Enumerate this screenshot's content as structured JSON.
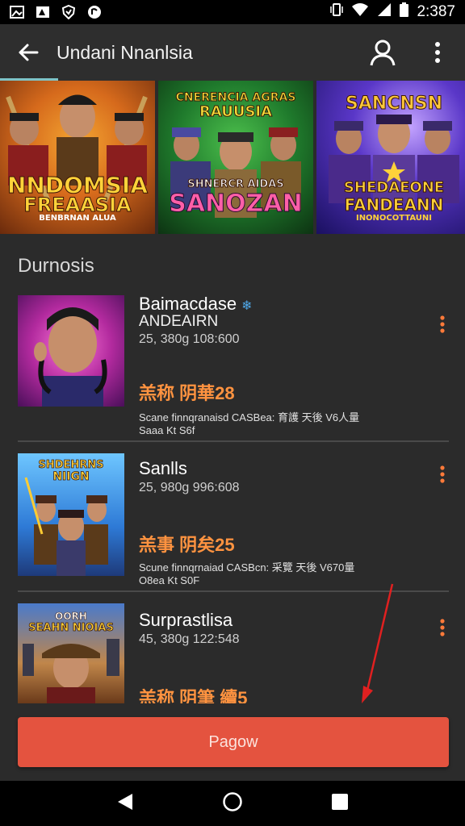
{
  "status_bar": {
    "time": "2:387"
  },
  "app_bar": {
    "title": "Undani Nnanlsia"
  },
  "banner": [
    {
      "title_line1": "NNDOMSIA",
      "title_line2": "FREAASIA",
      "caption": "BENBRNAN ALUA"
    },
    {
      "title_top1": "CNERENCIA AGRAS",
      "title_top2": "RAUUSIA",
      "title_line1": "SHNERCR AIDAS",
      "title_line2": "SANOZAN"
    },
    {
      "title_top1": "SANCNSN",
      "title_line1": "SHEDAEONE",
      "title_line2": "FANDEANN",
      "caption": "INONOCOTTAUNI"
    }
  ],
  "section": {
    "title": "Durnosis"
  },
  "items": [
    {
      "title": "Baimacdase",
      "verified": true,
      "subtitle": "ANDEAIRN",
      "meta": "25, 380g 108:600",
      "price": "羔称 阴華28",
      "desc1": "Scane finnqranaisd CASBea: 育護 天後 V6人量",
      "desc2": "Saaa Kt S6f"
    },
    {
      "title": "Sanlls",
      "verified": false,
      "subtitle": "",
      "meta": "25, 980g 996:608",
      "price": "羔事 阴矣25",
      "desc1": "Scune finnqrnaiad CASBcn: 采覽 天後 V670量",
      "desc2": "O8ea Kt S0F",
      "thumb_top": "SHDEHRNS",
      "thumb_bottom": "NIIGN"
    },
    {
      "title": "Surprastlisa",
      "verified": false,
      "subtitle": "",
      "meta": "45, 380g 122:548",
      "price": "羔称 阴筆 續5",
      "desc1": "",
      "desc2": "",
      "thumb_top": "OORH",
      "thumb_bottom": "SEAHN NIOIAS"
    }
  ],
  "primary_button": {
    "label": "Pagow"
  },
  "colors": {
    "accent": "#e4533f",
    "price": "#ff9340",
    "background": "#2b2b2b"
  }
}
